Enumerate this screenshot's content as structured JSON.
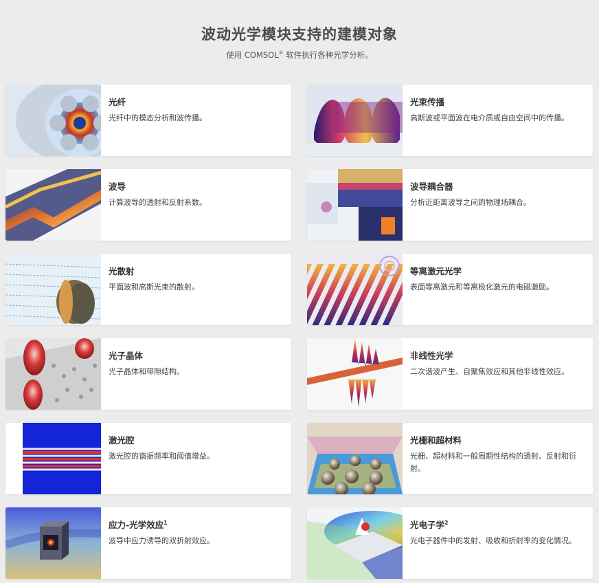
{
  "header": {
    "title": "波动光学模块支持的建模对象",
    "subtitle_prefix": "使用 COMSOL",
    "subtitle_reg": "®",
    "subtitle_suffix": " 软件执行各种光学分析。"
  },
  "cards": [
    {
      "title": "光纤",
      "sup": "",
      "desc": "光纤中的模态分析和波传播。",
      "icon": "optical-fiber-icon"
    },
    {
      "title": "光束传播",
      "sup": "",
      "desc": "高斯波或平面波在电介质或自由空间中的传播。",
      "icon": "beam-propagation-icon"
    },
    {
      "title": "波导",
      "sup": "",
      "desc": "计算波导的透射和反射系数。",
      "icon": "waveguide-icon"
    },
    {
      "title": "波导耦合器",
      "sup": "",
      "desc": "分析近距离波导之间的物理场耦合。",
      "icon": "waveguide-coupler-icon"
    },
    {
      "title": "光散射",
      "sup": "",
      "desc": "平面波和高斯光束的散射。",
      "icon": "light-scattering-icon"
    },
    {
      "title": "等离激元光学",
      "sup": "",
      "desc": "表面等离激元和等离极化激元的电磁激励。",
      "icon": "plasmonics-icon"
    },
    {
      "title": "光子晶体",
      "sup": "",
      "desc": "光子晶体和带隙结构。",
      "icon": "photonic-crystal-icon"
    },
    {
      "title": "非线性光学",
      "sup": "",
      "desc": "二次谐波产生、自聚焦效应和其他非线性效应。",
      "icon": "nonlinear-optics-icon"
    },
    {
      "title": "激光腔",
      "sup": "",
      "desc": "激光腔的谐振频率和阈值增益。",
      "icon": "laser-cavity-icon"
    },
    {
      "title": "光栅和超材料",
      "sup": "",
      "desc": "光栅、超材料和一般周期性结构的透射、反射和衍射。",
      "icon": "grating-metamaterial-icon"
    },
    {
      "title": "应力-光学效应",
      "sup": "1",
      "desc": "波导中应力诱导的双折射效应。",
      "icon": "stress-optical-icon"
    },
    {
      "title": "光电子学",
      "sup": "2",
      "desc": "光电子器件中的发射、吸收和折射率的变化情况。",
      "icon": "optoelectronics-icon"
    }
  ]
}
